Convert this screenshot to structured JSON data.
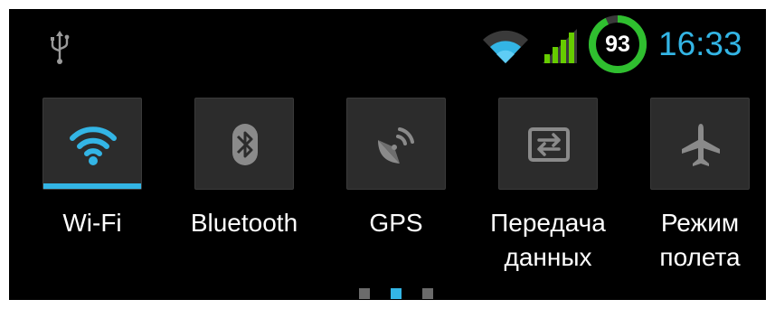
{
  "status_bar": {
    "icons": [
      "usb-icon",
      "wifi-icon",
      "signal-icon"
    ],
    "battery_level": "93",
    "battery_fraction": 0.93,
    "time": "16:33"
  },
  "quick_settings": {
    "tiles": [
      {
        "icon": "wifi-icon",
        "label": "Wi-Fi",
        "active": true
      },
      {
        "icon": "bluetooth-icon",
        "label": "Bluetooth",
        "active": false
      },
      {
        "icon": "gps-icon",
        "label": "GPS",
        "active": false
      },
      {
        "icon": "data-transfer-icon",
        "label": "Передача\nданных",
        "active": false
      },
      {
        "icon": "airplane-icon",
        "label": "Режим\nполета",
        "active": false
      }
    ]
  },
  "page_indicator": {
    "pages": 3,
    "current": 2
  },
  "colors": {
    "accent": "#33b5e5",
    "battery_ring": "#2fbf2f",
    "icon_inactive": "#8a8a8a",
    "dot_inactive": "#6b6b6b"
  }
}
